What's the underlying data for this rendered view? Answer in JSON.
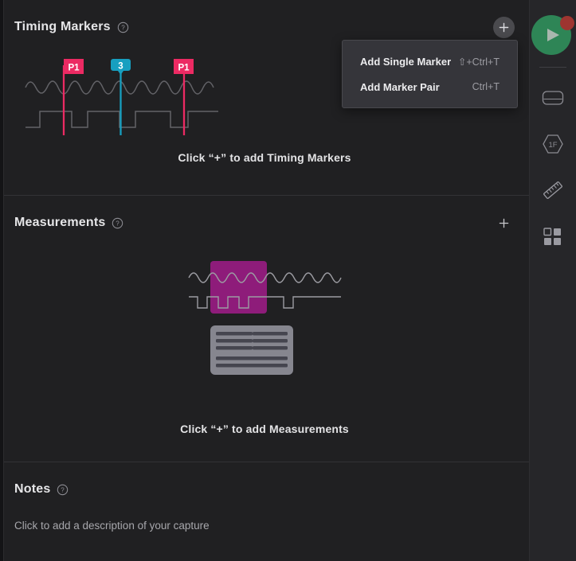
{
  "sections": {
    "timing_markers": {
      "title": "Timing Markers",
      "help_icon": "help-circle-icon",
      "add_icon": "plus-icon",
      "empty_caption": "Click “+” to add Timing Markers",
      "illustration": {
        "markers": [
          {
            "label": "P1",
            "color": "#ec2a63",
            "shape": "flag"
          },
          {
            "label": "3",
            "color": "#179fc0",
            "shape": "pin"
          },
          {
            "label": "P1",
            "color": "#ec2a63",
            "shape": "flag"
          }
        ],
        "analog_wave_color": "#6e6e73",
        "digital_wave_color": "#6e6e73"
      }
    },
    "measurements": {
      "title": "Measurements",
      "help_icon": "help-circle-icon",
      "add_icon": "plus-icon",
      "empty_caption": "Click “+” to add Measurements",
      "illustration": {
        "selection_color": "#8e1c7a",
        "wave_color": "#9c9ca2",
        "card_color": "#86868f",
        "card_bar_color": "#45454f"
      }
    },
    "notes": {
      "title": "Notes",
      "help_icon": "help-circle-icon",
      "placeholder": "Click to add a description of your capture"
    }
  },
  "marker_menu": {
    "items": [
      {
        "label": "Add Single Marker",
        "shortcut": "⇧+Ctrl+T"
      },
      {
        "label": "Add Marker Pair",
        "shortcut": "Ctrl+T"
      }
    ]
  },
  "rail": {
    "items": [
      {
        "name": "record-button",
        "icon": "play-record-icon",
        "badge": true,
        "color": "#2e8556",
        "badge_color": "#9e3530"
      },
      {
        "name": "device-button",
        "icon": "device-icon",
        "badge": false
      },
      {
        "name": "firmware-button",
        "icon": "1f-hexagon-icon",
        "badge": false,
        "label": "1F"
      },
      {
        "name": "ruler-button",
        "icon": "ruler-icon",
        "badge": false
      },
      {
        "name": "blocks-button",
        "icon": "blocks-icon",
        "badge": false
      }
    ]
  },
  "theme": {
    "background": "#202022",
    "panel_background": "#1c1c1e",
    "rail_background": "#262629",
    "divider": "#323236",
    "text_primary": "#e6e6e8",
    "text_secondary": "#a7a7ac",
    "menu_background": "#35353a",
    "accent_pink": "#ec2a63",
    "accent_cyan": "#179fc0",
    "accent_magenta": "#8e1c7a"
  }
}
